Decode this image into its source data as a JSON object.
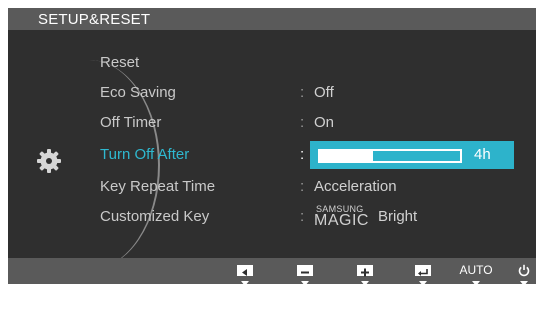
{
  "header": {
    "title": "SETUP&RESET"
  },
  "menu": {
    "items": [
      {
        "label": "Reset",
        "value": ""
      },
      {
        "label": "Eco Saving",
        "value": "Off"
      },
      {
        "label": "Off Timer",
        "value": "On"
      },
      {
        "label": "Turn Off After",
        "value": "4h",
        "selected": true
      },
      {
        "label": "Key Repeat Time",
        "value": "Acceleration"
      },
      {
        "label": "Customized Key",
        "value_top": "SAMSUNG",
        "value_bottom": "MAGIC",
        "value_suffix": "Bright"
      }
    ],
    "separator": ":"
  },
  "slider": {
    "fraction": 0.38,
    "value_label": "4h"
  },
  "footer": {
    "buttons": [
      {
        "icon": "left-icon"
      },
      {
        "icon": "minus-icon"
      },
      {
        "icon": "plus-icon"
      },
      {
        "icon": "enter-icon"
      },
      {
        "label": "AUTO"
      },
      {
        "icon": "power-icon"
      }
    ]
  },
  "colors": {
    "accent": "#2db3cb",
    "background": "#2f2f2f",
    "bar": "#5a5a5a"
  }
}
